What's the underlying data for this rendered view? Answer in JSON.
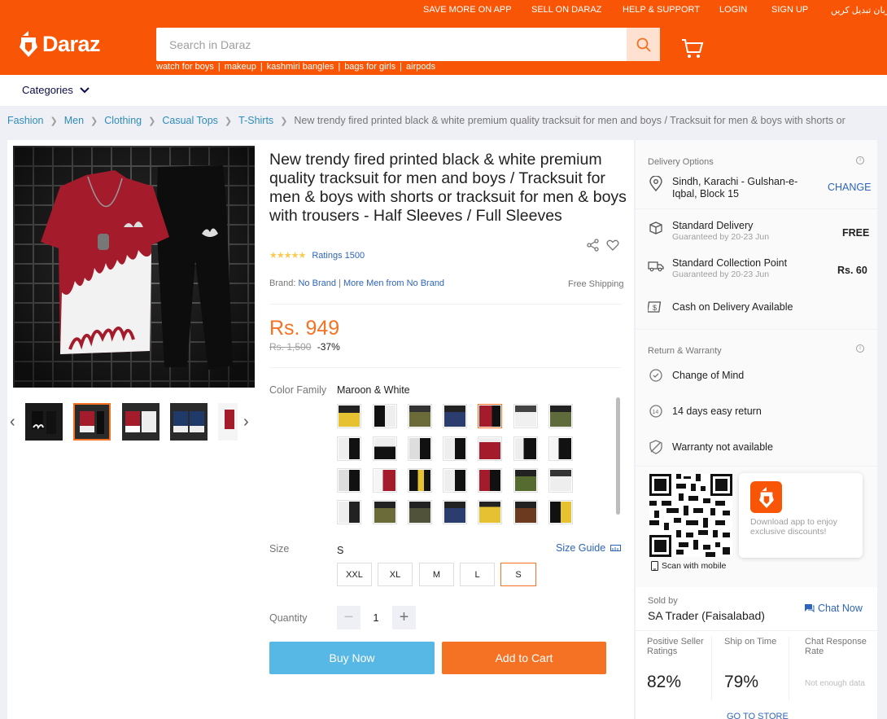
{
  "colors": {
    "brand": "#f85606",
    "accent": "#f57224",
    "link": "#2e64bb",
    "buy_now": "#57b8e5"
  },
  "topbar": {
    "links": [
      "SAVE MORE ON APP",
      "SELL ON DARAZ",
      "HELP & SUPPORT",
      "LOGIN",
      "SIGN UP",
      "زبان تبدیل کریں"
    ]
  },
  "header": {
    "logo_text": "Daraz",
    "search_placeholder": "Search in Daraz",
    "trending": [
      "watch for boys",
      "makeup",
      "kashmiri bangles",
      "bags for girls",
      "airpods"
    ]
  },
  "nav": {
    "categories_label": "Categories"
  },
  "breadcrumb": [
    "Fashion",
    "Men",
    "Clothing",
    "Casual Tops",
    "T-Shirts"
  ],
  "breadcrumb_current": "New trendy fired printed black & white premium quality tracksuit for men and boys / Tracksuit for men & boys with shorts or",
  "product": {
    "title": "New trendy fired printed black & white premium quality tracksuit for men and boys / Tracksuit for men & boys with shorts or tracksuit for men & boys with trousers - Half Sleeves / Full Sleeves",
    "rating_stars": 4.5,
    "ratings_text": "Ratings 1500",
    "brand_label": "Brand:",
    "brand_value": "No Brand",
    "more_from": "More Men from No Brand",
    "free_shipping": "Free Shipping",
    "price": "Rs. 949",
    "old_price": "Rs. 1,500",
    "discount": "-37%",
    "color_label": "Color Family",
    "color_value": "Maroon & White",
    "size_label": "Size",
    "size_value": "S",
    "size_guide": "Size Guide",
    "sizes": [
      "XXL",
      "XL",
      "M",
      "L",
      "S"
    ],
    "quantity_label": "Quantity",
    "quantity": "1",
    "buy_now": "Buy Now",
    "add_to_cart": "Add to Cart"
  },
  "delivery": {
    "title": "Delivery Options",
    "location": "Sindh, Karachi - Gulshan-e-Iqbal, Block 15",
    "change": "CHANGE",
    "standard_delivery": "Standard Delivery",
    "standard_delivery_sub": "Guaranteed by 20-23 Jun",
    "standard_delivery_price": "FREE",
    "collection_point": "Standard Collection Point",
    "collection_point_sub": "Guaranteed by 20-23 Jun",
    "collection_point_price": "Rs. 60",
    "cod": "Cash on Delivery Available"
  },
  "returns": {
    "title": "Return & Warranty",
    "change_of_mind": "Change of Mind",
    "easy_return": "14 days easy return",
    "warranty": "Warranty not available"
  },
  "app": {
    "scan": "Scan with mobile",
    "download": "Download app to enjoy exclusive discounts!"
  },
  "seller": {
    "sold_by": "Sold by",
    "name": "SA Trader (Faisalabad)",
    "chat": "Chat Now",
    "metrics": [
      {
        "label": "Positive Seller Ratings",
        "value": "82%"
      },
      {
        "label": "Ship on Time",
        "value": "79%"
      },
      {
        "label": "Chat Response Rate",
        "value": "Not enough data"
      }
    ],
    "go_to_store": "GO TO STORE"
  }
}
